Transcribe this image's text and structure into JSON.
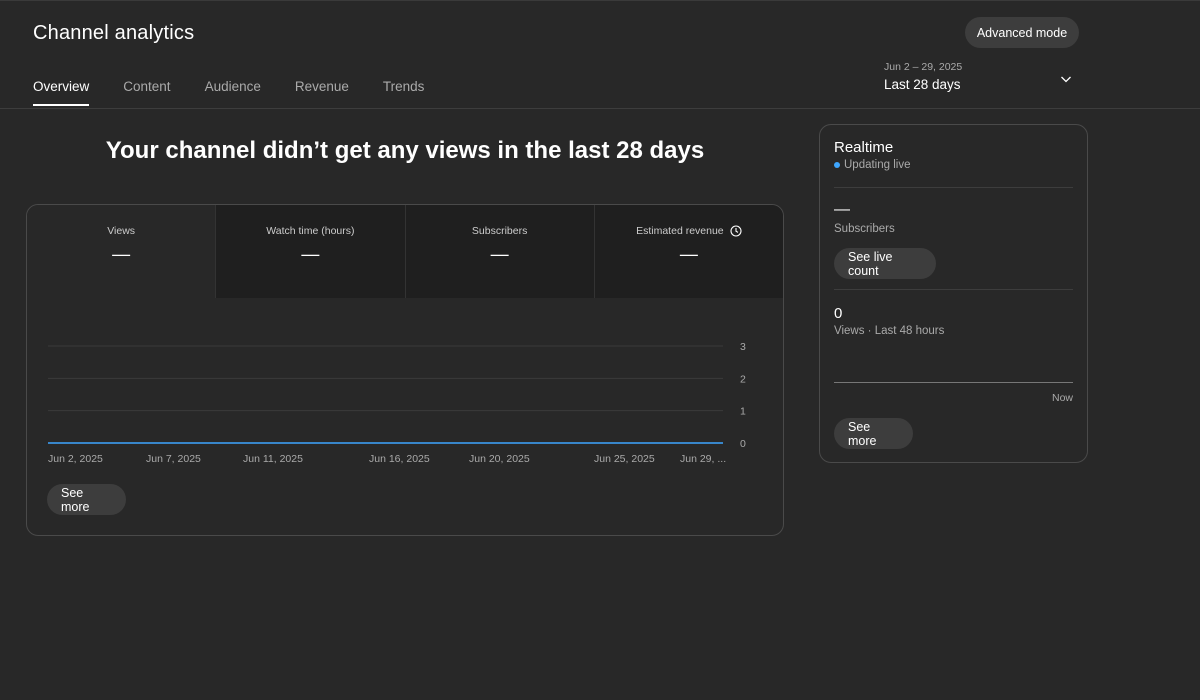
{
  "header": {
    "title": "Channel analytics",
    "advanced_mode_label": "Advanced mode",
    "tabs": [
      {
        "label": "Overview",
        "active": true
      },
      {
        "label": "Content",
        "active": false
      },
      {
        "label": "Audience",
        "active": false
      },
      {
        "label": "Revenue",
        "active": false
      },
      {
        "label": "Trends",
        "active": false
      }
    ],
    "date_picker": {
      "range": "Jun 2 – 29, 2025",
      "label": "Last 28 days"
    }
  },
  "main": {
    "heading": "Your channel didn’t get any views in the last 28 days",
    "metrics": [
      {
        "label": "Views",
        "value": "—",
        "active": true,
        "icon": ""
      },
      {
        "label": "Watch time (hours)",
        "value": "—",
        "active": false,
        "icon": ""
      },
      {
        "label": "Subscribers",
        "value": "—",
        "active": false,
        "icon": ""
      },
      {
        "label": "Estimated revenue",
        "value": "—",
        "active": false,
        "icon": "clock-icon"
      }
    ],
    "see_more_label": "See more"
  },
  "chart_data": {
    "type": "line",
    "x": [
      "Jun 2, 2025",
      "Jun 7, 2025",
      "Jun 11, 2025",
      "Jun 16, 2025",
      "Jun 20, 2025",
      "Jun 25, 2025",
      "Jun 29, ..."
    ],
    "series": [
      {
        "values": [
          0,
          0,
          0,
          0,
          0,
          0,
          0
        ]
      }
    ],
    "y_ticks": [
      0,
      1,
      2,
      3
    ],
    "ylim": [
      0,
      3
    ],
    "grid": true,
    "line_color": "#3ea6ff"
  },
  "realtime": {
    "title": "Realtime",
    "status": "Updating live",
    "subscribers_value": "—",
    "subscribers_label": "Subscribers",
    "live_count_label": "See live count",
    "views_value": "0",
    "views_label": "Views · Last 48 hours",
    "now_label": "Now",
    "see_more_label": "See more"
  },
  "colors": {
    "background": "#282828",
    "accent": "#3ea6ff",
    "button": "#3d3d3d"
  }
}
